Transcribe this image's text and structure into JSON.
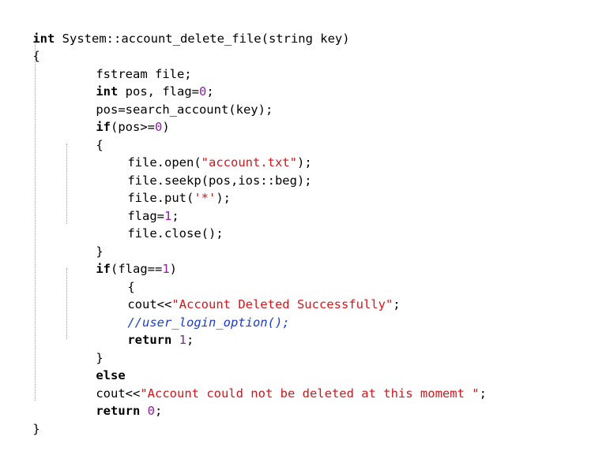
{
  "code": {
    "signature": {
      "kw_int": "int",
      "rest": " System::account_delete_file(string key)"
    },
    "open_brace": "{",
    "decl_file": "fstream file;",
    "decl_pos": {
      "kw_int": "int",
      "mid": " pos, flag=",
      "num": "0",
      "end": ";"
    },
    "search_call": "pos=search_account(key);",
    "if_pos": {
      "kw_if": "if",
      "open": "(pos>=",
      "num": "0",
      "close": ")"
    },
    "inner_open_1": "{",
    "open_call": {
      "pre": "file.open(",
      "str": "\"account.txt\"",
      "post": ");"
    },
    "seekp_call": "file.seekp(pos,ios::beg);",
    "put_call": {
      "pre": "file.put(",
      "str": "'*'",
      "post": ");"
    },
    "flag_set": {
      "pre": "flag=",
      "num": "1",
      "post": ";"
    },
    "close_call": "file.close();",
    "inner_close_1": "}",
    "if_flag": {
      "kw_if": "if",
      "open": "(flag==",
      "num": "1",
      "close": ")"
    },
    "inner_open_2": "{",
    "cout_success": {
      "pre": "cout<<",
      "str": "\"Account Deleted Successfully\"",
      "post": ";"
    },
    "comment_line": "//user_login_option();",
    "return_one": {
      "kw_return": "return",
      "mid": " ",
      "num": "1",
      "end": ";"
    },
    "inner_close_2": "}",
    "kw_else": "else",
    "cout_fail": {
      "pre": "cout<<",
      "str": "\"Account could not be deleted at this momemt \"",
      "post": ";"
    },
    "return_zero": {
      "kw_return": "return",
      "mid": " ",
      "num": "0",
      "end": ";"
    },
    "close_brace": "}"
  },
  "colors": {
    "keyword": "#000000",
    "number": "#8e20a4",
    "string": "#d4161b",
    "comment": "#1b3bd1",
    "indent_guide": "#9a9a9a"
  }
}
